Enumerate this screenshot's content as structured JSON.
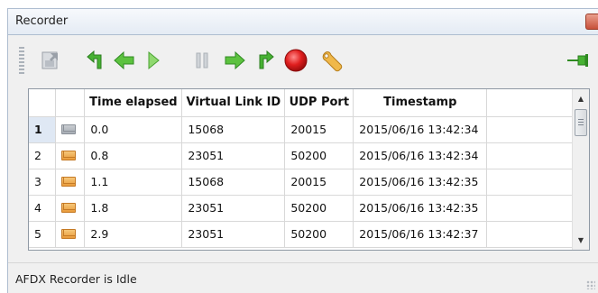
{
  "window": {
    "title": "Recorder"
  },
  "toolbar": {
    "buttons": [
      {
        "name": "export-icon",
        "enabled": false
      },
      {
        "name": "rewind-icon",
        "enabled": true
      },
      {
        "name": "step-back-icon",
        "enabled": true
      },
      {
        "name": "play-icon",
        "enabled": true
      },
      {
        "name": "pause-icon",
        "enabled": false
      },
      {
        "name": "step-forward-icon",
        "enabled": true
      },
      {
        "name": "fast-forward-icon",
        "enabled": true
      },
      {
        "name": "record-icon",
        "enabled": true
      },
      {
        "name": "wrench-icon",
        "enabled": true
      },
      {
        "name": "pin-icon",
        "enabled": true
      }
    ]
  },
  "table": {
    "columns": [
      "",
      "",
      "Time elapsed",
      "Virtual Link ID",
      "UDP Port",
      "Timestamp"
    ],
    "rows": [
      {
        "index": "1",
        "time": "0.0",
        "vlid": "15068",
        "port": "20015",
        "timestamp": "2015/06/16  13:42:34",
        "selected": true
      },
      {
        "index": "2",
        "time": "0.8",
        "vlid": "23051",
        "port": "50200",
        "timestamp": "2015/06/16  13:42:34",
        "selected": false
      },
      {
        "index": "3",
        "time": "1.1",
        "vlid": "15068",
        "port": "20015",
        "timestamp": "2015/06/16  13:42:35",
        "selected": false
      },
      {
        "index": "4",
        "time": "1.8",
        "vlid": "23051",
        "port": "50200",
        "timestamp": "2015/06/16  13:42:35",
        "selected": false
      },
      {
        "index": "5",
        "time": "2.9",
        "vlid": "23051",
        "port": "50200",
        "timestamp": "2015/06/16  13:42:37",
        "selected": false
      }
    ]
  },
  "status": {
    "text": "AFDX Recorder is Idle"
  },
  "colors": {
    "accent_green": "#3aa12a",
    "record_red": "#e01e1e",
    "selected_row": "#dfe8f4"
  }
}
